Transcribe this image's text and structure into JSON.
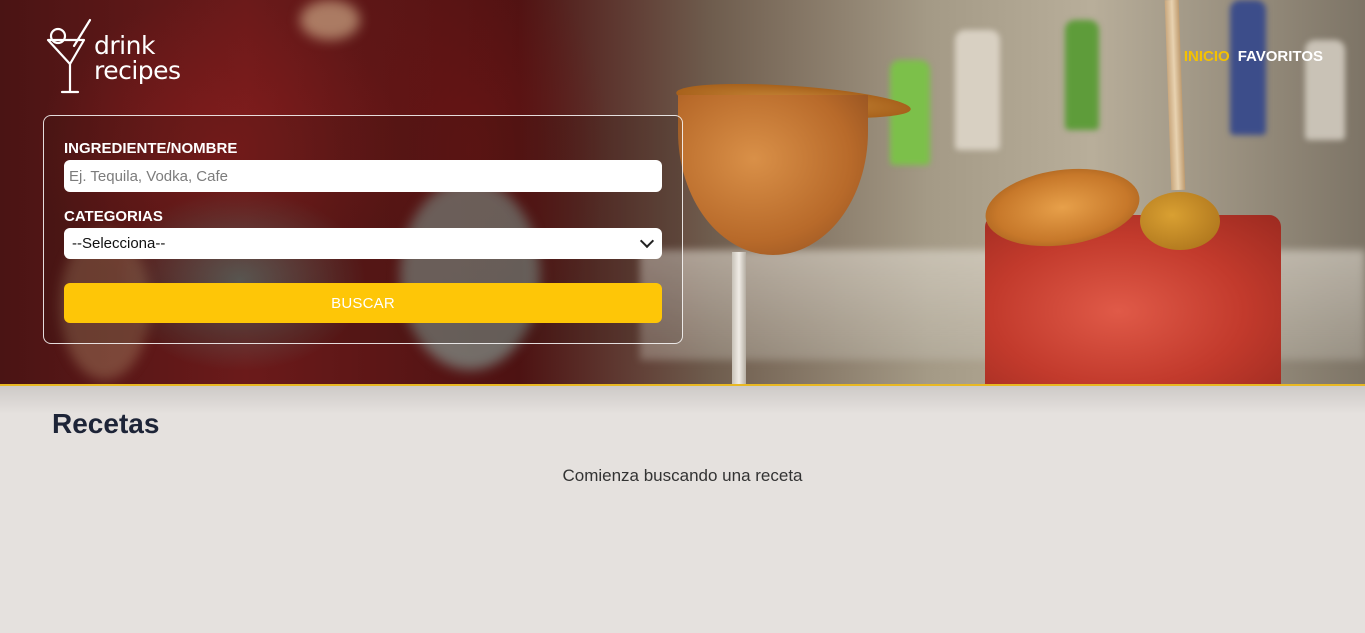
{
  "logo": {
    "line1": "drink",
    "line2": "recipes"
  },
  "nav": [
    {
      "label": "INICIO",
      "active": true
    },
    {
      "label": "FAVORITOS",
      "active": false
    }
  ],
  "search": {
    "ingredient_label": "INGREDIENTE/NOMBRE",
    "ingredient_placeholder": "Ej. Tequila, Vodka, Cafe",
    "ingredient_value": "",
    "category_label": "CATEGORIAS",
    "category_selected": "--Selecciona--",
    "button_label": "BUSCAR"
  },
  "main": {
    "title": "Recetas",
    "empty_message": "Comienza buscando una receta"
  },
  "colors": {
    "accent": "#fec607",
    "nav_active": "#f5c200",
    "title": "#1d2437",
    "background": "#e5e1de"
  }
}
